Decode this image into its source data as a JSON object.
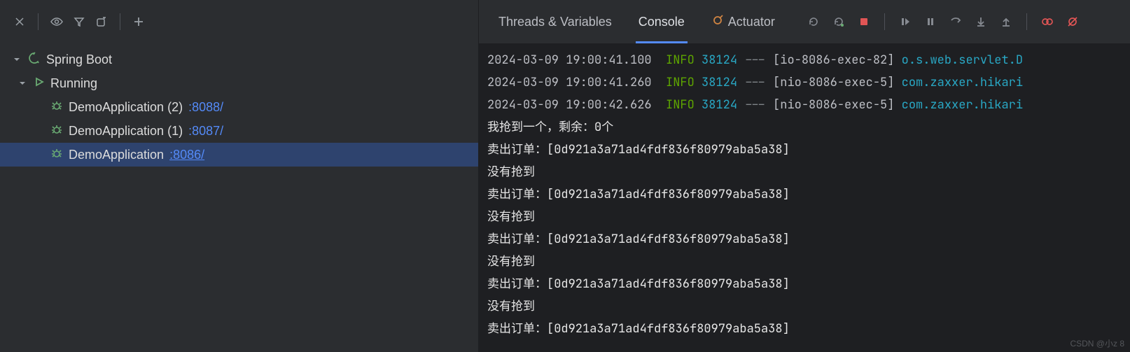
{
  "tree": {
    "root": "Spring Boot",
    "group": "Running",
    "apps": [
      {
        "name": "DemoApplication (2)",
        "port": ":8088/",
        "selected": false
      },
      {
        "name": "DemoApplication (1)",
        "port": ":8087/",
        "selected": false
      },
      {
        "name": "DemoApplication",
        "port": ":8086/",
        "selected": true
      }
    ]
  },
  "tabs": {
    "threads": "Threads & Variables",
    "console": "Console",
    "actuator": "Actuator"
  },
  "log": {
    "lines": [
      {
        "time": "2024-03-09 19:00:41.100",
        "level": "INFO",
        "pid": "38124",
        "thread": "[io-8086-exec-82]",
        "cls": "o.s.web.servlet.D"
      },
      {
        "time": "2024-03-09 19:00:41.260",
        "level": "INFO",
        "pid": "38124",
        "thread": "[nio-8086-exec-5]",
        "cls": "com.zaxxer.hikari"
      },
      {
        "time": "2024-03-09 19:00:42.626",
        "level": "INFO",
        "pid": "38124",
        "thread": "[nio-8086-exec-5]",
        "cls": "com.zaxxer.hikari"
      }
    ],
    "out": [
      "我抢到一个，剩余：0个",
      "卖出订单：[0d921a3a71ad4fdf836f80979aba5a38]",
      "没有抢到",
      "卖出订单：[0d921a3a71ad4fdf836f80979aba5a38]",
      "没有抢到",
      "卖出订单：[0d921a3a71ad4fdf836f80979aba5a38]",
      "没有抢到",
      "卖出订单：[0d921a3a71ad4fdf836f80979aba5a38]",
      "没有抢到",
      "卖出订单：[0d921a3a71ad4fdf836f80979aba5a38]"
    ]
  },
  "watermark": "CSDN @小z 8"
}
